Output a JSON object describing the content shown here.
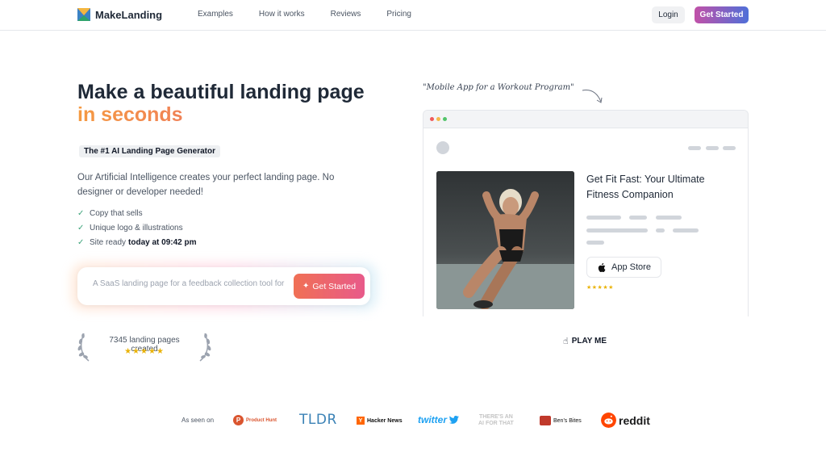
{
  "header": {
    "brand": "MakeLanding",
    "nav": [
      "Examples",
      "How it works",
      "Reviews",
      "Pricing"
    ],
    "login_label": "Login",
    "cta_label": "Get Started"
  },
  "hero": {
    "title_line1": "Make a beautiful landing page",
    "title_line2": "in seconds",
    "badge": "The #1 AI Landing Page Generator",
    "description": "Our Artificial Intelligence creates your perfect landing page. No designer or developer needed!",
    "features": [
      {
        "text": "Copy that sells",
        "strong": ""
      },
      {
        "text": "Unique logo & illustrations",
        "strong": ""
      },
      {
        "text": "Site ready",
        "strong": "today at 09:42 pm"
      }
    ],
    "prompt_placeholder": "A SaaS landing page for a feedback collection tool for",
    "prompt_button": "Get Started",
    "stat_text": "7345 landing pages created",
    "stat_stars": "★★★★★"
  },
  "preview": {
    "hint": "\"Mobile App for a Workout Program\"",
    "mock_title": "Get Fit Fast: Your Ultimate Fitness Companion",
    "appstore_label": "App Store",
    "mock_stars": "★★★★★",
    "play_label": "PLAY ME"
  },
  "seen_on": {
    "label": "As seen on",
    "logos": {
      "producthunt": "Product Hunt",
      "tldr": "TLDR",
      "hackernews": "Hacker News",
      "twitter": "twitter",
      "aiforthat_line1": "THERE'S AN",
      "aiforthat_line2": "AI FOR THAT",
      "bensbites": "Ben's Bites",
      "reddit": "reddit"
    }
  },
  "colors": {
    "accent_orange": "#f59a42",
    "accent_pink": "#e8587a",
    "cta_gradient_start": "#c151a8",
    "cta_gradient_end": "#4f6fd8",
    "check_green": "#3ca37a",
    "star_gold": "#eab308"
  }
}
